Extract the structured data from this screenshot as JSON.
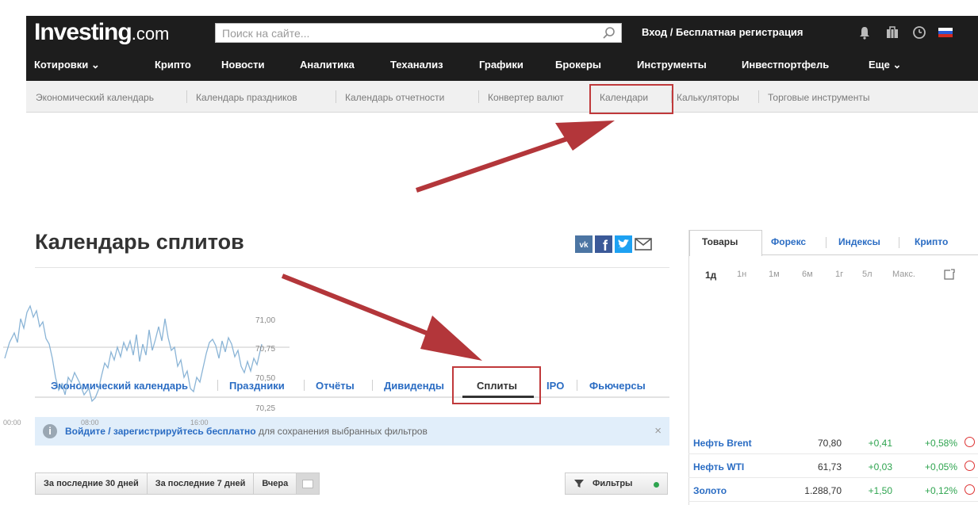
{
  "header": {
    "logo_main": "Investing",
    "logo_suffix": ".com",
    "search_placeholder": "Поиск на сайте...",
    "login": "Вход / Бесплатная регистрация"
  },
  "main_nav": {
    "quotes": "Котировки ⌄",
    "crypto": "Крипто",
    "news": "Новости",
    "analytics": "Аналитика",
    "tech": "Теханализ",
    "charts": "Графики",
    "brokers": "Брокеры",
    "tools": "Инструменты",
    "portfolio": "Инвестпортфель",
    "more": "Еще ⌄"
  },
  "sub_nav": {
    "econ_calendar": "Экономический календарь",
    "holidays_calendar": "Календарь праздников",
    "earnings_calendar": "Календарь отчетности",
    "converter": "Конвертер валют",
    "calendars": "Календари",
    "calculators": "Калькуляторы",
    "trading_tools": "Торговые инструменты"
  },
  "page": {
    "title": "Календарь сплитов"
  },
  "tabs": {
    "economic": "Экономический календарь",
    "holidays": "Праздники",
    "reports": "Отчёты",
    "dividends": "Дивиденды",
    "splits": "Сплиты",
    "ipo": "IPO",
    "futures": "Фьючерсы"
  },
  "info": {
    "link": "Войдите / зарегистрируйтесь бесплатно",
    "text": " для сохранения выбранных фильтров",
    "close": "×"
  },
  "buttons": {
    "last30": "За последние 30 дней",
    "last7": "За последние 7 дней",
    "yesterday": "Вчера",
    "filters": "Фильтры"
  },
  "widget": {
    "tabs": {
      "goods": "Товары",
      "forex": "Форекс",
      "indices": "Индексы",
      "crypto": "Крипто"
    },
    "periods": [
      "1д",
      "1н",
      "1м",
      "6м",
      "1г",
      "5л",
      "Макс."
    ],
    "chart_axis": {
      "y_ticks": [
        "71,00",
        "70,75",
        "70,50",
        "70,25"
      ],
      "x_ticks": [
        "00:00",
        "08:00",
        "16:00"
      ]
    },
    "quotes": [
      {
        "name": "Нефть Brent",
        "value": "70,80",
        "change": "+0,41",
        "pct": "+0,58%"
      },
      {
        "name": "Нефть WTI",
        "value": "61,73",
        "change": "+0,03",
        "pct": "+0,05%"
      },
      {
        "name": "Золото",
        "value": "1.288,70",
        "change": "+1,50",
        "pct": "+0,12%"
      }
    ]
  },
  "colors": {
    "header_bg": "#1d1d1d",
    "link_blue": "#2a6cc3",
    "annotation_red": "#c0393b",
    "positive_green": "#2ea44f"
  }
}
